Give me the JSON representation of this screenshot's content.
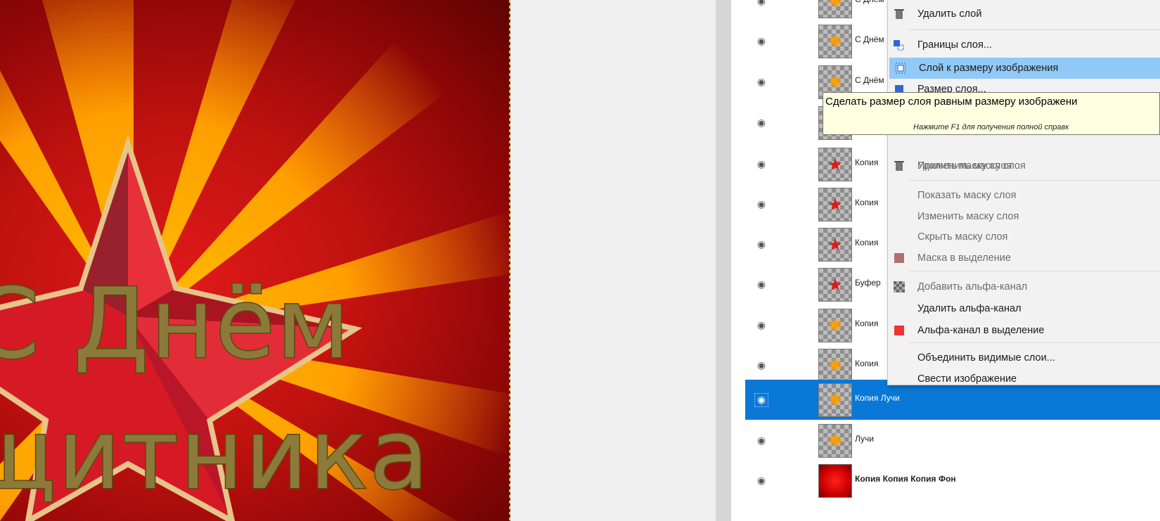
{
  "canvas": {
    "text_line1": "С Днём",
    "text_line2": "щитника"
  },
  "layers": [
    {
      "name": "С Днём",
      "thumb": "rays",
      "visible": true
    },
    {
      "name": "С Днём",
      "thumb": "rays",
      "visible": true
    },
    {
      "name": "С Днём",
      "thumb": "rays",
      "visible": true
    },
    {
      "name": "",
      "thumb": "rays",
      "visible": true
    },
    {
      "name": "Копия",
      "thumb": "star",
      "visible": true
    },
    {
      "name": "Копия",
      "thumb": "star",
      "visible": true
    },
    {
      "name": "Копия",
      "thumb": "star",
      "visible": true
    },
    {
      "name": "Буфер",
      "thumb": "star",
      "visible": true
    },
    {
      "name": "Копия",
      "thumb": "rays",
      "visible": true
    },
    {
      "name": "Копия",
      "thumb": "rays",
      "visible": true
    },
    {
      "name": "Копия Лучи",
      "thumb": "rays",
      "visible": true,
      "selected": true
    },
    {
      "name": "Лучи",
      "thumb": "rays",
      "visible": true
    },
    {
      "name": "Копия Копия Копия Фон",
      "thumb": "red",
      "visible": true,
      "bold": true
    }
  ],
  "context_menu": {
    "items": [
      {
        "label": "Удалить слой",
        "icon": "trash-icon"
      },
      {
        "label": "Границы слоя...",
        "icon": "layer-boundary-icon"
      },
      {
        "label": "Слой к размеру изображения",
        "icon": "layer-to-image-size-icon",
        "hover": true
      },
      {
        "label": "Размер слоя...",
        "icon": "scale-layer-icon"
      },
      {
        "label": "Применить маску слоя",
        "icon": "",
        "disabled": true
      },
      {
        "label": "Удалить маску слоя",
        "icon": "trash-icon",
        "disabled": true
      },
      {
        "label": "Показать маску слоя",
        "icon": "",
        "disabled": true
      },
      {
        "label": "Изменить маску слоя",
        "icon": "",
        "disabled": true
      },
      {
        "label": "Скрыть маску слоя",
        "icon": "",
        "disabled": true
      },
      {
        "label": "Маска в выделение",
        "icon": "mask-to-selection-icon",
        "disabled": true
      },
      {
        "label": "Добавить альфа-канал",
        "icon": "add-alpha-icon",
        "disabled": true
      },
      {
        "label": "Удалить альфа-канал",
        "icon": ""
      },
      {
        "label": "Альфа-канал в выделение",
        "icon": "alpha-to-selection-icon"
      },
      {
        "label": "Объединить видимые слои...",
        "icon": ""
      },
      {
        "label": "Свести изображение",
        "icon": ""
      }
    ]
  },
  "tooltip": {
    "text": "Сделать размер слоя равным размеру изображени",
    "hint": "Нажмите F1 для получения полной справк"
  },
  "colors": {
    "selection": "#0a78d7",
    "menu_hover": "#91c9f7",
    "tooltip_bg": "#ffffe1"
  }
}
